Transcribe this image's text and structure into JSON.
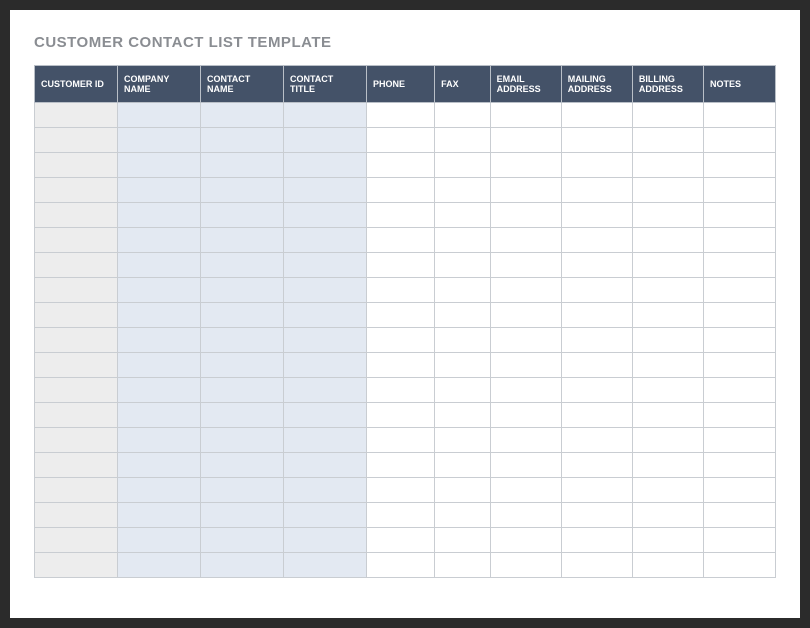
{
  "title": "CUSTOMER CONTACT LIST TEMPLATE",
  "columns": [
    {
      "key": "customer_id",
      "label": "CUSTOMER ID"
    },
    {
      "key": "company_name",
      "label": "COMPANY NAME"
    },
    {
      "key": "contact_name",
      "label": "CONTACT NAME"
    },
    {
      "key": "contact_title",
      "label": "CONTACT TITLE"
    },
    {
      "key": "phone",
      "label": "PHONE"
    },
    {
      "key": "fax",
      "label": "FAX"
    },
    {
      "key": "email_address",
      "label": "EMAIL ADDRESS"
    },
    {
      "key": "mailing_address",
      "label": "MAILING ADDRESS"
    },
    {
      "key": "billing_address",
      "label": "BILLING ADDRESS"
    },
    {
      "key": "notes",
      "label": "NOTES"
    }
  ],
  "rows": [
    {},
    {},
    {},
    {},
    {},
    {},
    {},
    {},
    {},
    {},
    {},
    {},
    {},
    {},
    {},
    {},
    {},
    {},
    {}
  ],
  "colors": {
    "header_bg": "#445268",
    "id_col_bg": "#ededed",
    "shaded_col_bg": "#e3e9f2",
    "title_text": "#8a8d92"
  }
}
